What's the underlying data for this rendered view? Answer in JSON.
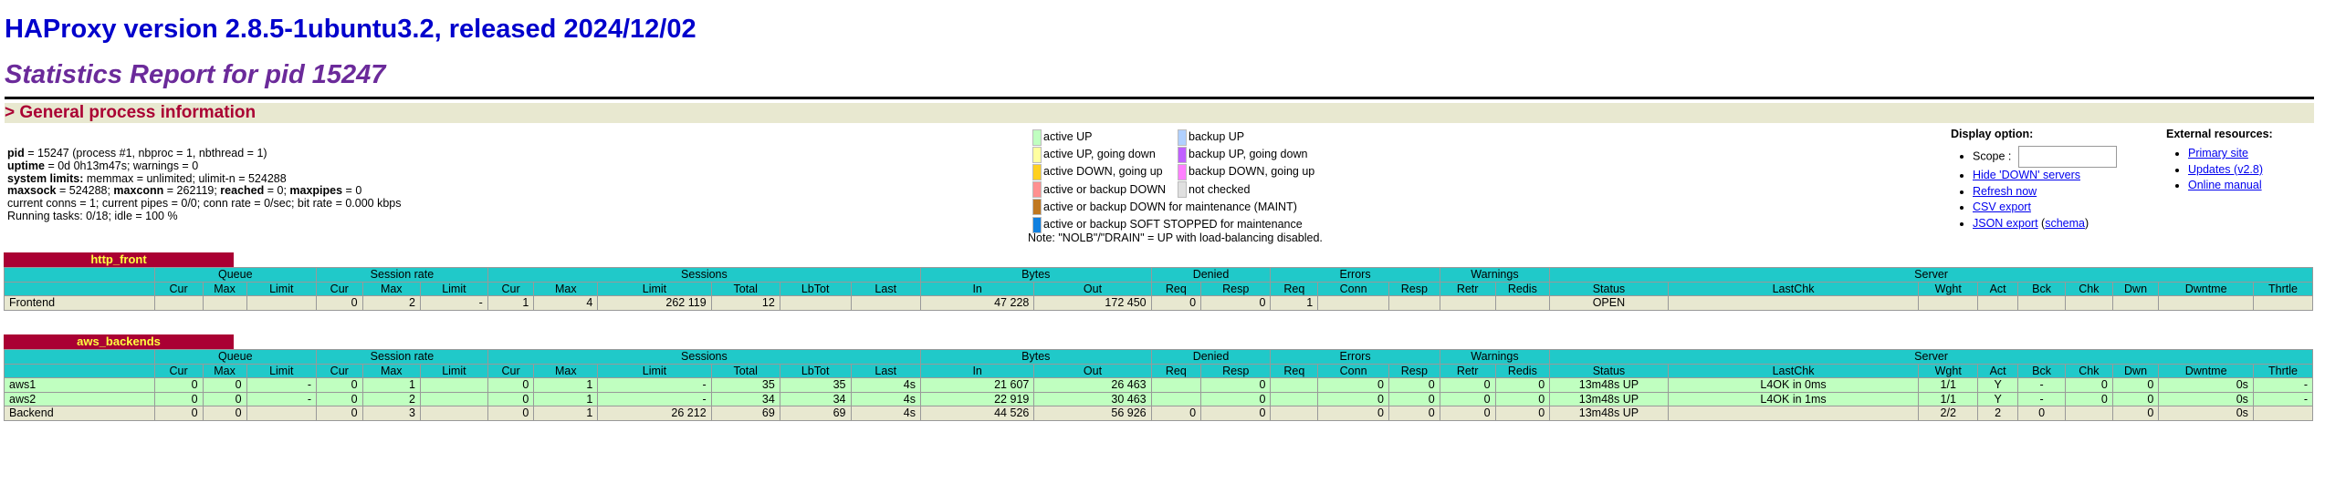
{
  "header": {
    "title": "HAProxy version 2.8.5-1ubuntu3.2, released 2024/12/02",
    "subtitle": "Statistics Report for pid 15247"
  },
  "general": {
    "heading": "> General process information",
    "lines": [
      {
        "k": "pid",
        "v": " = 15247 (process #1, nbproc = 1, nbthread = 1)"
      },
      {
        "k": "uptime",
        "v": " = 0d 0h13m47s; warnings = 0"
      },
      {
        "k": "system limits:",
        "v": " memmax = unlimited; ulimit-n = 524288"
      },
      {
        "k": "maxsock",
        "v": " = 524288; ",
        "k2": "maxconn",
        "v2": " = 262119; ",
        "k3": "reached",
        "v3": " = 0; ",
        "k4": "maxpipes",
        "v4": " = 0"
      },
      {
        "k": "",
        "v": "current conns = 1; current pipes = 0/0; conn rate = 0/sec; bit rate = 0.000 kbps"
      },
      {
        "k": "",
        "v": "Running tasks: 0/18; idle = 100 %"
      }
    ]
  },
  "legend": {
    "col1": [
      {
        "label": "active UP",
        "color": "#c0ffc0"
      },
      {
        "label": "active UP, going down",
        "color": "#ffffa0"
      },
      {
        "label": "active DOWN, going up",
        "color": "#ffd020"
      },
      {
        "label": "active or backup DOWN",
        "color": "#ff9090"
      },
      {
        "label": "active or backup DOWN for maintenance (MAINT)",
        "color": "#c07820"
      },
      {
        "label": "active or backup SOFT STOPPED for maintenance",
        "color": "#1080e0"
      }
    ],
    "col2": [
      {
        "label": "backup UP",
        "color": "#b0d0ff"
      },
      {
        "label": "backup UP, going down",
        "color": "#c060ff"
      },
      {
        "label": "backup DOWN, going up",
        "color": "#ff80ff"
      },
      {
        "label": "not checked",
        "color": "#e0e0e0"
      }
    ],
    "note": "Note: \"NOLB\"/\"DRAIN\" = UP with load-balancing disabled."
  },
  "display": {
    "title": "Display option:",
    "scope_label": "Scope : ",
    "scope_value": "",
    "hide_down": "Hide 'DOWN' servers",
    "refresh": "Refresh now",
    "csv": "CSV export",
    "json": "JSON export",
    "schema_open": " (",
    "schema": "schema",
    "schema_close": ")"
  },
  "external": {
    "title": "External resources:",
    "links": [
      "Primary site",
      "Updates (v2.8)",
      "Online manual"
    ]
  },
  "headers": {
    "groups": [
      "Queue",
      "Session rate",
      "Sessions",
      "Bytes",
      "Denied",
      "Errors",
      "Warnings",
      "Server"
    ],
    "cols": [
      "Cur",
      "Max",
      "Limit",
      "Cur",
      "Max",
      "Limit",
      "Cur",
      "Max",
      "Limit",
      "Total",
      "LbTot",
      "Last",
      "In",
      "Out",
      "Req",
      "Resp",
      "Req",
      "Conn",
      "Resp",
      "Retr",
      "Redis",
      "Status",
      "LastChk",
      "Wght",
      "Act",
      "Bck",
      "Chk",
      "Dwn",
      "Dwntme",
      "Thrtle"
    ]
  },
  "http_front": {
    "name": "http_front",
    "rows": [
      {
        "name": "Frontend",
        "cells": [
          "",
          "",
          "",
          "0",
          "2",
          "-",
          "1",
          "4",
          "262 119",
          "12",
          "",
          "",
          "47 228",
          "172 450",
          "0",
          "0",
          "1",
          "",
          "",
          "",
          "",
          "OPEN",
          "",
          "",
          "",
          "",
          "",
          "",
          "",
          ""
        ]
      }
    ]
  },
  "aws_backends": {
    "name": "aws_backends",
    "rows": [
      {
        "name": "aws1",
        "cells": [
          "0",
          "0",
          "-",
          "0",
          "1",
          "",
          "0",
          "1",
          "-",
          "35",
          "35",
          "4s",
          "21 607",
          "26 463",
          "",
          "0",
          "",
          "0",
          "0",
          "0",
          "0",
          "13m48s UP",
          "L4OK in 0ms",
          "1/1",
          "Y",
          "-",
          "0",
          "0",
          "0s",
          "-"
        ]
      },
      {
        "name": "aws2",
        "cells": [
          "0",
          "0",
          "-",
          "0",
          "2",
          "",
          "0",
          "1",
          "-",
          "34",
          "34",
          "4s",
          "22 919",
          "30 463",
          "",
          "0",
          "",
          "0",
          "0",
          "0",
          "0",
          "13m48s UP",
          "L4OK in 1ms",
          "1/1",
          "Y",
          "-",
          "0",
          "0",
          "0s",
          "-"
        ]
      },
      {
        "name": "Backend",
        "cells": [
          "0",
          "0",
          "",
          "0",
          "3",
          "",
          "0",
          "1",
          "26 212",
          "69",
          "69",
          "4s",
          "44 526",
          "56 926",
          "0",
          "0",
          "",
          "0",
          "0",
          "0",
          "0",
          "13m48s UP",
          "",
          "2/2",
          "2",
          "0",
          "",
          "0",
          "0s",
          ""
        ]
      }
    ]
  }
}
